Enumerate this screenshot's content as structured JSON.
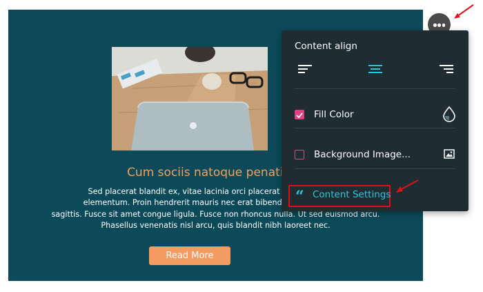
{
  "card": {
    "title": "Cum sociis natoque penatibus",
    "body": "Sed placerat blandit ex, vitae lacinia orci placerat id. Duis vitae ar elementum. Proin hendrerit mauris nec erat bibendum iaculis. Sed p sagittis. Fusce sit amet congue ligula. Fusce non rhoncus nulla. Ut sed euismod arcu. Phasellus venenatis nisl arcu, quis blandit nibh laoreet nec.",
    "body_lines": [
      "Sed placerat blandit ex, vitae lacinia orci placerat id. Duis vitae ar",
      "elementum. Proin hendrerit mauris nec erat bibendum iaculis. Sed p",
      "sagittis. Fusce sit amet congue ligula. Fusce non rhoncus nulla. Ut sed euismod arcu.",
      "Phasellus venenatis nisl arcu, quis blandit nibh laoreet nec."
    ],
    "button_label": "Read More",
    "image": "laptop-on-desk-photo"
  },
  "panel": {
    "title": "Content align",
    "align_options": [
      "align-left-icon",
      "align-center-icon",
      "align-right-icon"
    ],
    "selected_align": "align-center-icon",
    "fill_color": {
      "label": "Fill Color",
      "checked": true,
      "icon": "drop-icon"
    },
    "background_image": {
      "label": "Background Image...",
      "checked": false,
      "icon": "image-icon"
    },
    "content_settings": {
      "label": "Content Settings",
      "icon": "quote-icon"
    }
  },
  "colors": {
    "card_bg": "#0c4a5a",
    "accent": "#2bc8dc",
    "title": "#f5a05a",
    "button": "#f39b62",
    "panel_bg": "#1f2d33",
    "checkbox": "#e43e86",
    "highlight": "#e0101a"
  }
}
